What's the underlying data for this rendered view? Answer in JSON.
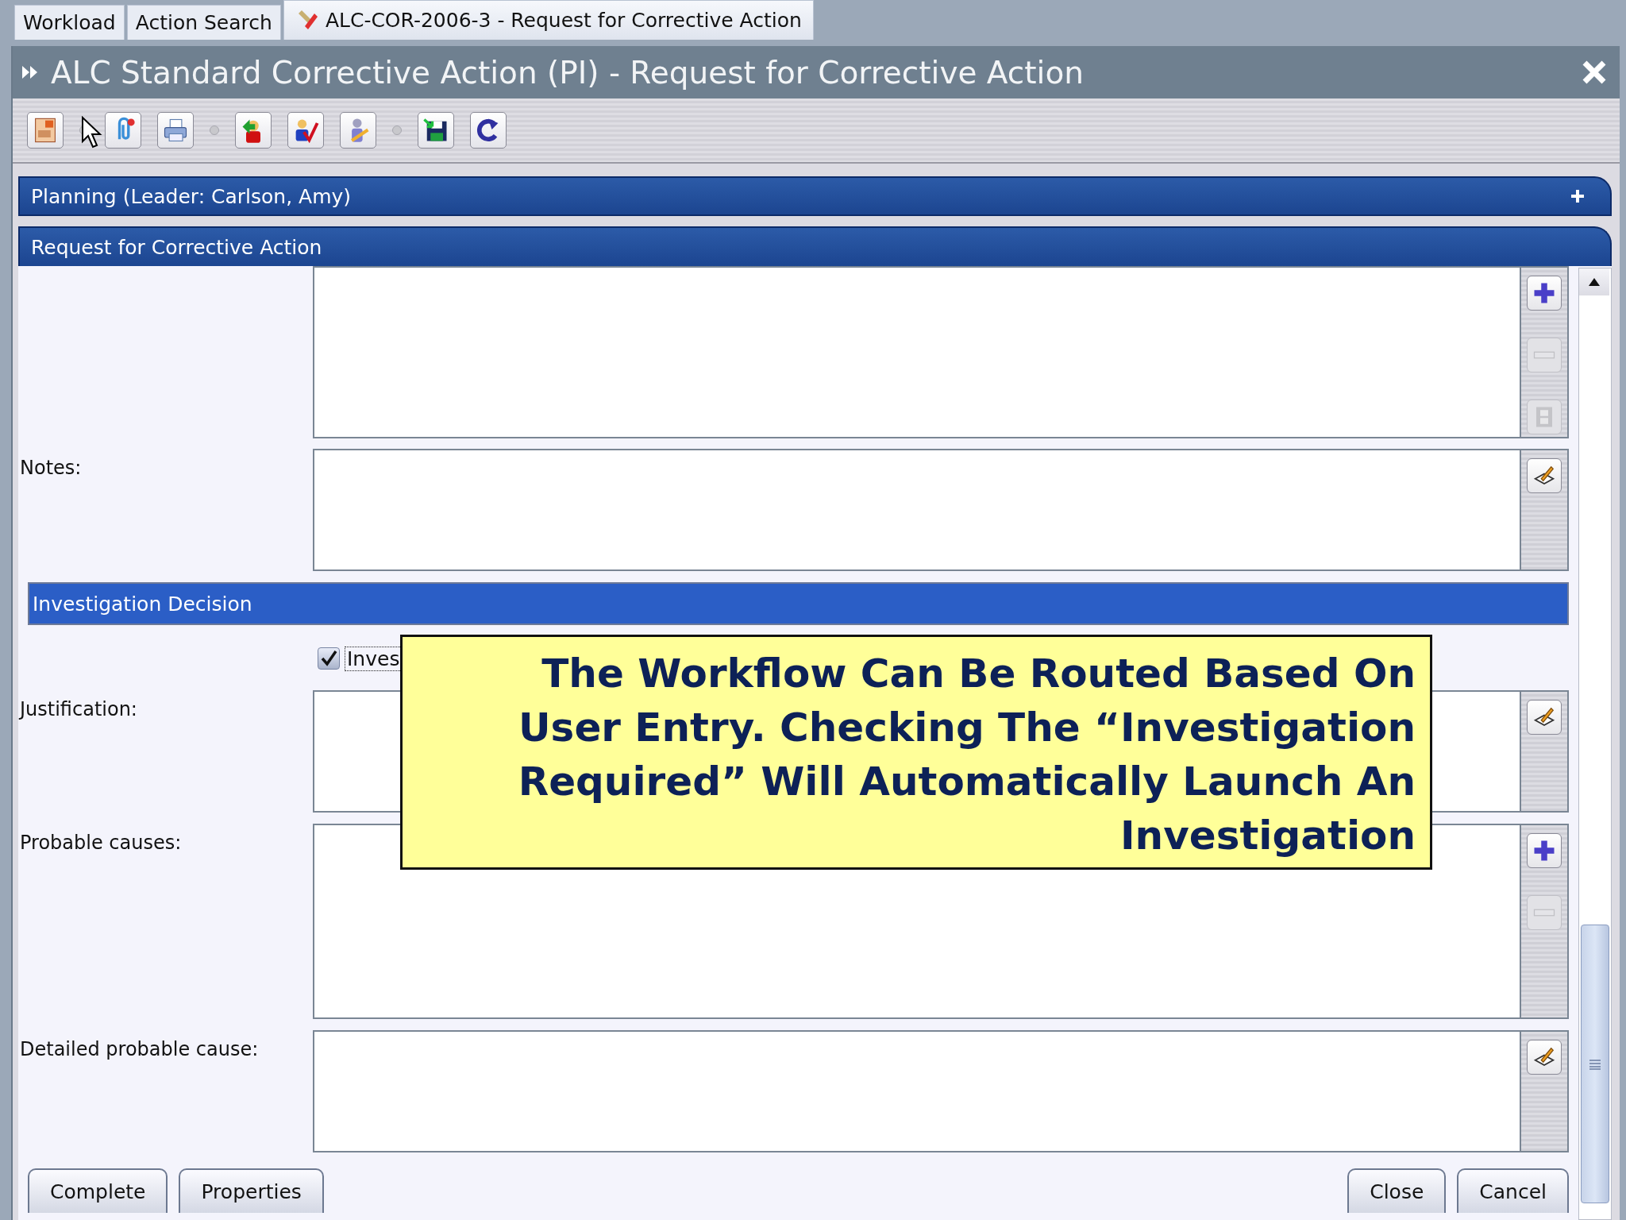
{
  "tabs": [
    {
      "label": "Workload",
      "selected": false
    },
    {
      "label": "Action Search",
      "selected": false
    },
    {
      "label": "ALC-COR-2006-3 - Request for Corrective Action",
      "selected": true
    }
  ],
  "window": {
    "title": "ALC Standard Corrective Action (PI) - Request for Corrective Action"
  },
  "toolbar": [
    {
      "kind": "report"
    },
    {
      "kind": "separator"
    },
    {
      "kind": "attach"
    },
    {
      "kind": "print"
    },
    {
      "kind": "separator"
    },
    {
      "kind": "reassign"
    },
    {
      "kind": "approve"
    },
    {
      "kind": "edit-person"
    },
    {
      "kind": "separator"
    },
    {
      "kind": "save"
    },
    {
      "kind": "refresh"
    }
  ],
  "sections": [
    {
      "title": "Planning (Leader: Carlson, Amy)",
      "expanded": false
    },
    {
      "title": "Request for Corrective Action",
      "expanded": true
    }
  ],
  "form": [
    {
      "kind": "field",
      "buttons": [
        {
          "kind": "add",
          "disabled": false
        },
        {
          "kind": "remove",
          "disabled": true
        },
        {
          "kind": "film",
          "disabled": true
        }
      ]
    },
    {
      "kind": "field",
      "label": "Notes:",
      "buttons": [
        {
          "kind": "edit",
          "disabled": false
        }
      ]
    },
    {
      "kind": "header",
      "label": "Investigation Decision"
    },
    {
      "kind": "checkbox",
      "label": "Inves",
      "checked": true
    },
    {
      "kind": "field",
      "label": "Justification:",
      "buttons": [
        {
          "kind": "edit",
          "disabled": false
        }
      ]
    },
    {
      "kind": "field",
      "label": "Probable causes:",
      "buttons": [
        {
          "kind": "add",
          "disabled": false
        },
        {
          "kind": "remove",
          "disabled": true
        }
      ]
    },
    {
      "kind": "field",
      "label": "Detailed probable cause:",
      "buttons": [
        {
          "kind": "edit",
          "disabled": false
        }
      ]
    }
  ],
  "callout": {
    "text": "The Workflow Can Be Routed Based On User Entry. Checking The “Investigation Required” Will Automatically Launch An Investigation"
  },
  "buttons_left": [
    "Complete",
    "Properties"
  ],
  "buttons_right": [
    "Close",
    "Cancel"
  ]
}
